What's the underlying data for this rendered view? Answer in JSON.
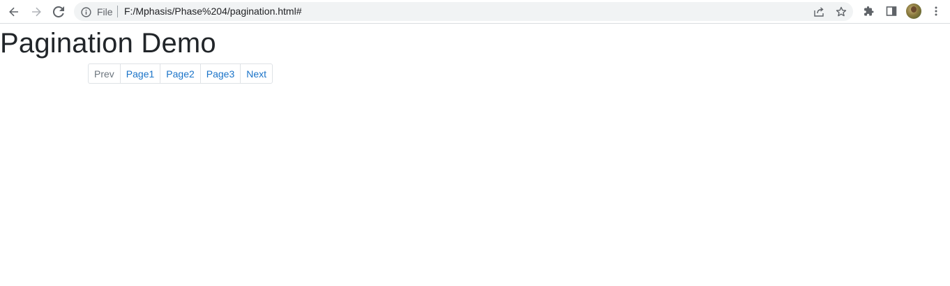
{
  "browser": {
    "site_info_label": "File",
    "url": "F:/Mphasis/Phase%204/pagination.html#"
  },
  "page": {
    "title": "Pagination Demo",
    "pagination": {
      "prev_label": "Prev",
      "pages": [
        "Page1",
        "Page2",
        "Page3"
      ],
      "next_label": "Next"
    }
  },
  "colors": {
    "link": "#1a73c8",
    "disabled": "#6c757d",
    "border": "#dee2e6",
    "title": "#212529",
    "omnibox_bg": "#f1f3f4"
  },
  "icons": [
    "back-arrow-icon",
    "forward-arrow-icon",
    "reload-icon",
    "info-icon",
    "share-icon",
    "star-icon",
    "extensions-puzzle-icon",
    "side-panel-icon",
    "avatar",
    "kebab-menu-icon"
  ]
}
